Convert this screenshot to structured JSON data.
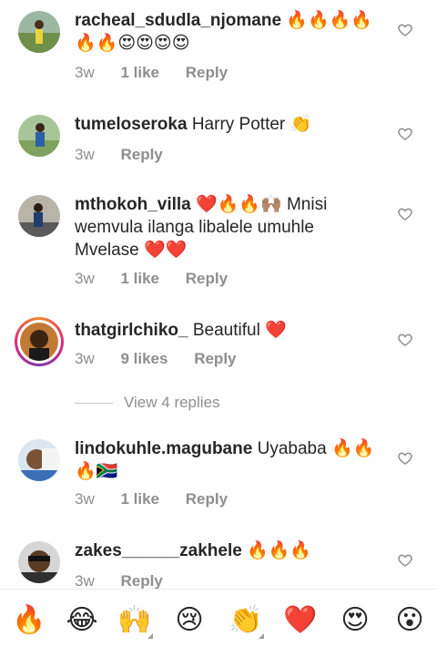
{
  "comments": [
    {
      "username": "racheal_sdudla_njomane",
      "text": "",
      "emoji": "🔥🔥🔥🔥🔥🔥😍😍😍😍",
      "time": "3w",
      "likes": "1 like",
      "reply": "Reply"
    },
    {
      "username": "tumeloseroka",
      "text": "Harry Potter",
      "emoji": "👏",
      "time": "3w",
      "likes": "",
      "reply": "Reply"
    },
    {
      "username": "mthokoh_villa",
      "emoji": "❤️🔥🔥🙌🏽",
      "text": "Mnisi wemvula ilanga libalele umuhle Mvelase",
      "emoji_after": "❤️❤️",
      "time": "3w",
      "likes": "1 like",
      "reply": "Reply"
    },
    {
      "username": "thatgirlchiko_",
      "text": "Beautiful",
      "emoji": "❤️",
      "time": "3w",
      "likes": "9 likes",
      "reply": "Reply"
    },
    {
      "username": "lindokuhle.magubane",
      "text": "Uyababa",
      "emoji": "🔥🔥🔥🇿🇦",
      "time": "3w",
      "likes": "1 like",
      "reply": "Reply"
    },
    {
      "username": "zakes______zakhele",
      "text": "",
      "emoji": "🔥🔥🔥",
      "time": "3w",
      "likes": "",
      "reply": "Reply"
    }
  ],
  "view_replies": "View 4 replies",
  "emoji_bar": [
    "🔥",
    "😂",
    "🙌",
    "😢",
    "👏",
    "❤️",
    "😍",
    "😮"
  ],
  "colors": {
    "text": "#262626",
    "secondary": "#8e8e8e",
    "heart_outline": "#8e8e8e"
  }
}
